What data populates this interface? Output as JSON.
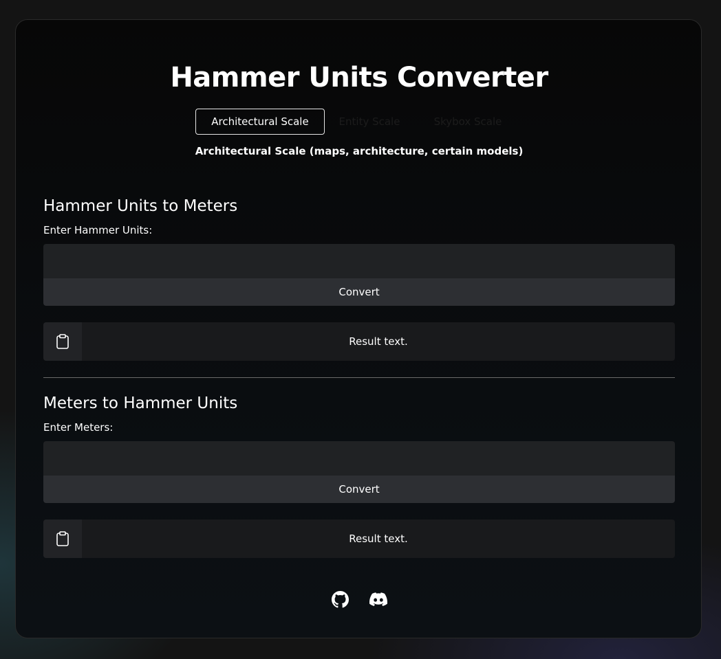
{
  "app": {
    "title": "Hammer Units Converter"
  },
  "tabs": [
    {
      "label": "Architectural Scale",
      "active": true
    },
    {
      "label": "Entity Scale",
      "active": false
    },
    {
      "label": "Skybox Scale",
      "active": false
    }
  ],
  "scale_description": "Architectural Scale (maps, architecture, certain models)",
  "hu_to_m": {
    "heading": "Hammer Units to Meters",
    "input_label": "Enter Hammer Units:",
    "input_value": "",
    "button_label": "Convert",
    "result": "Result text."
  },
  "m_to_hu": {
    "heading": "Meters to Hammer Units",
    "input_label": "Enter Meters:",
    "input_value": "",
    "button_label": "Convert",
    "result": "Result text."
  },
  "footer": {
    "links": [
      {
        "icon": "github-icon"
      },
      {
        "icon": "discord-icon"
      }
    ]
  },
  "colors": {
    "page_bg": "#141414",
    "card_bg": "#070707",
    "input_bg": "#202224",
    "button_bg": "#2d2f33",
    "result_bg": "#191a1c",
    "text": "#ffffff",
    "inactive_tab_text": "#1c1c1c"
  }
}
